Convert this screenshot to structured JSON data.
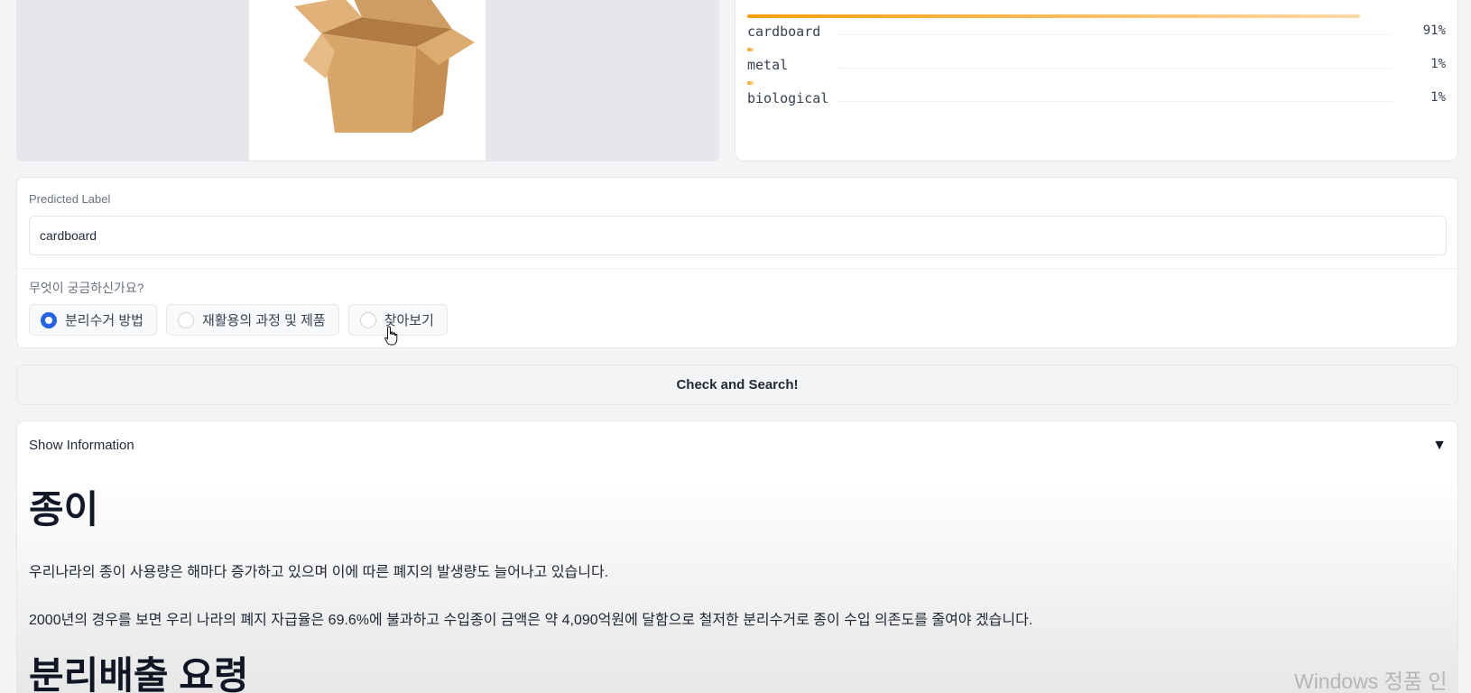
{
  "image_panel": {
    "image_icon": "cardboard-box-image"
  },
  "label_panel": {
    "confidences": [
      {
        "label": "cardboard",
        "percent_text": "91%",
        "value": 0.91
      },
      {
        "label": "metal",
        "percent_text": "1%",
        "value": 0.01
      },
      {
        "label": "biological",
        "percent_text": "1%",
        "value": 0.01
      }
    ]
  },
  "form": {
    "predicted_label_title": "Predicted Label",
    "predicted_label_value": "cardboard",
    "question": "무엇이 궁금하신가요?",
    "options": [
      {
        "label": "분리수거 방법",
        "checked": true
      },
      {
        "label": "재활용의 과정 및 제품",
        "checked": false
      },
      {
        "label": "찾아보기",
        "checked": false
      }
    ]
  },
  "button": {
    "label": "Check and Search!"
  },
  "info": {
    "header": "Show Information",
    "toggle_icon": "▼",
    "title": "종이",
    "para1": "우리나라의 종이 사용량은 해마다 증가하고 있으며 이에 따른 폐지의 발생량도 늘어나고 있습니다.",
    "para2": "2000년의 경우를 보면 우리 나라의 폐지 자급율은 69.6%에 불과하고 수입종이 금액은 약 4,090억원에 달함으로 철저한 분리수거로 종이 수입 의존도를 줄여야 겠습니다.",
    "subtitle": "분리배출 요령"
  },
  "watermark": "Windows 정품 인",
  "colors": {
    "accent": "#2563eb",
    "bar": "#f59e0b"
  }
}
